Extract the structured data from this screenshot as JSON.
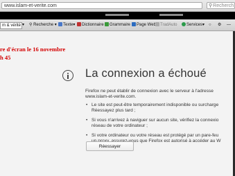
{
  "browser": {
    "url": "www.islam-et-verite.com",
    "search_placeholder": "Recherch"
  },
  "toolbar": {
    "site_combo": "m & vérité",
    "search_combo": "Recherche",
    "items": [
      "Texte",
      "Dictionnaire",
      "Grammaire",
      "Page Web",
      "TradAuto",
      "Services"
    ]
  },
  "annotation": {
    "line1": "re d'écran le 16 novembre",
    "line2": "h 45"
  },
  "error": {
    "title": "La connexion a échoué",
    "description": "Firefox ne peut établir de connexion avec le serveur à l'adresse",
    "domain": "www.islam-et-verite.com.",
    "bullets": [
      {
        "line1": "Le site est peut-être temporairement indisponible ou surcharge",
        "line2": "Réessayez plus tard ;"
      },
      {
        "line1": "Si vous n'arrivez à naviguer sur aucun site, vérifiez la connexio",
        "line2": "réseau de votre ordinateur ;"
      },
      {
        "line1": "Si votre ordinateur ou votre réseau est protégé par un pare-feu",
        "line2": "un proxy, assurez-vous que Firefox est autorisé à accéder au W"
      }
    ],
    "retry_label": "Réessayer"
  }
}
